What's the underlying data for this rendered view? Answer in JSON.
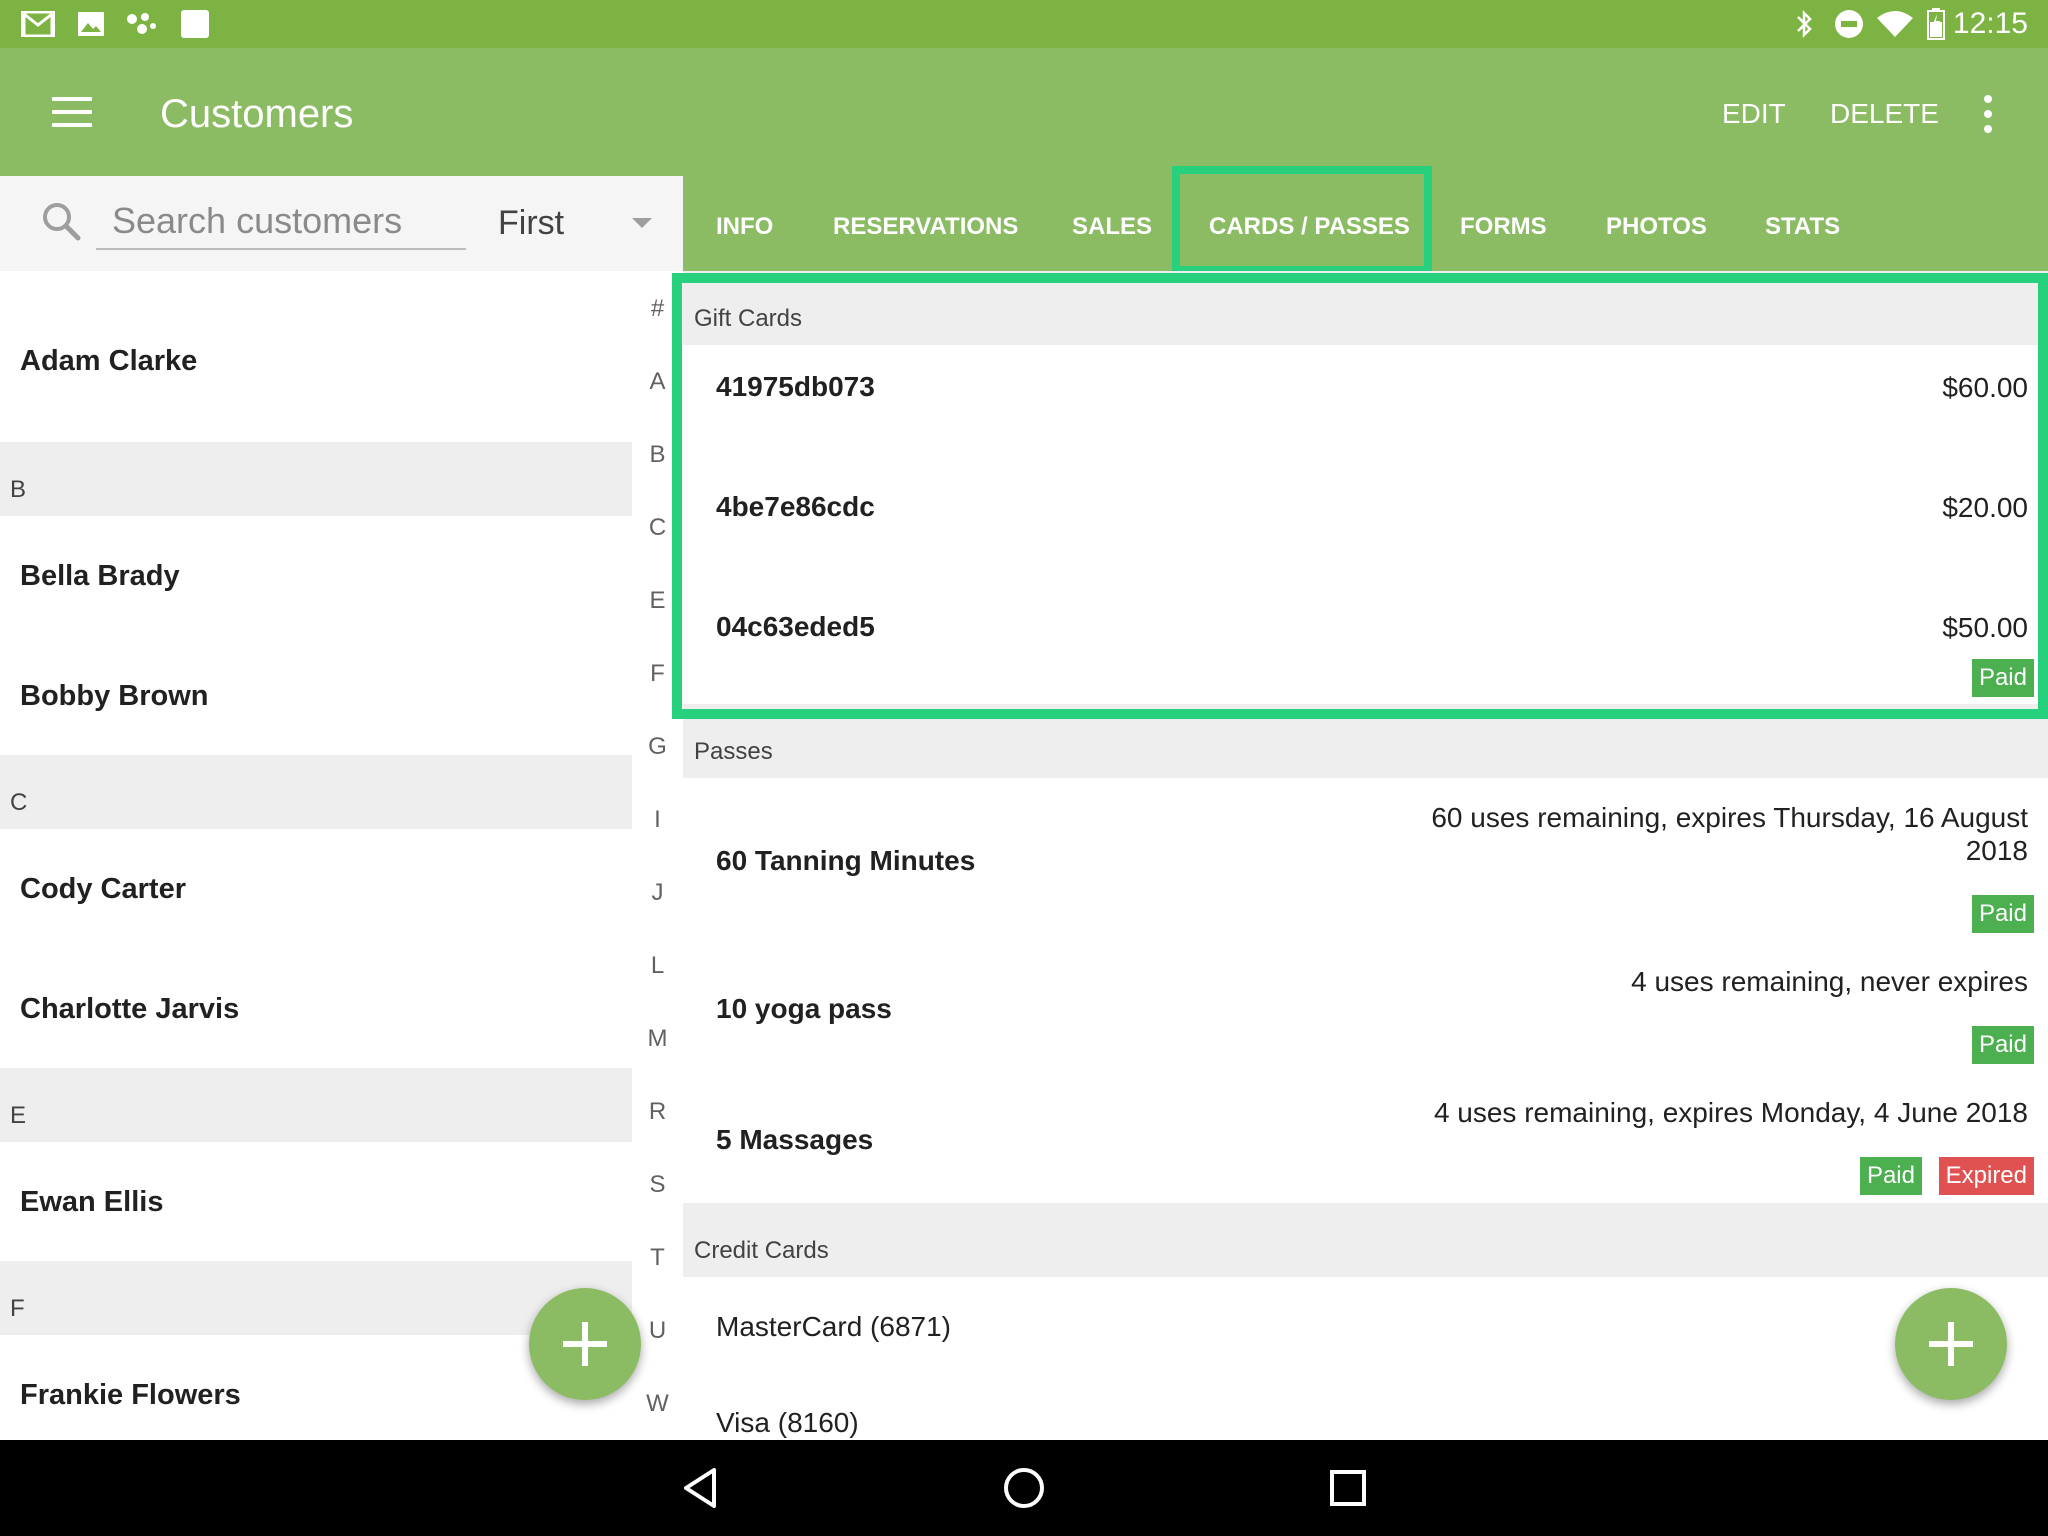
{
  "status_bar": {
    "time": "12:15",
    "left_icons": [
      "gmail-icon",
      "photos-icon",
      "app-icon",
      "square-app-icon"
    ],
    "right_icons": [
      "bluetooth-icon",
      "do-not-disturb-icon",
      "wifi-icon",
      "battery-icon"
    ]
  },
  "app_bar": {
    "title": "Customers",
    "edit_label": "EDIT",
    "delete_label": "DELETE"
  },
  "search": {
    "placeholder": "Search customers",
    "sort_value": "First"
  },
  "customers": {
    "rows": [
      {
        "header": null,
        "name": "Adam Clarke"
      },
      {
        "header": "B",
        "name": "Bella Brady"
      },
      {
        "header": null,
        "name": "Bobby Brown"
      },
      {
        "header": "C",
        "name": "Cody Carter"
      },
      {
        "header": null,
        "name": "Charlotte Jarvis"
      },
      {
        "header": "E",
        "name": "Ewan Ellis"
      },
      {
        "header": "F",
        "name": "Frankie Flowers"
      }
    ],
    "headers": [
      "B",
      "C",
      "E",
      "F"
    ],
    "names": [
      "Adam Clarke",
      "Bella Brady",
      "Bobby Brown",
      "Cody Carter",
      "Charlotte Jarvis",
      "Ewan Ellis",
      "Frankie Flowers"
    ]
  },
  "alphabet_index": [
    "#",
    "A",
    "B",
    "C",
    "E",
    "F",
    "G",
    "I",
    "J",
    "L",
    "M",
    "R",
    "S",
    "T",
    "U",
    "W"
  ],
  "tabs": [
    "INFO",
    "RESERVATIONS",
    "SALES",
    "CARDS / PASSES",
    "FORMS",
    "PHOTOS",
    "STATS"
  ],
  "active_tab": "CARDS / PASSES",
  "gift_cards": {
    "header": "Gift Cards",
    "items": [
      {
        "code": "41975db073",
        "amount": "$60.00"
      },
      {
        "code": "4be7e86cdc",
        "amount": "$20.00"
      },
      {
        "code": "04c63eded5",
        "amount": "$50.00",
        "badge": "Paid"
      }
    ]
  },
  "passes": {
    "header": "Passes",
    "items": [
      {
        "name": "60 Tanning Minutes",
        "status_line1": "60 uses remaining, expires Thursday, 16 August",
        "status_line2": "2018",
        "badge": "Paid"
      },
      {
        "name": "10 yoga pass",
        "status": "4 uses remaining, never expires",
        "badge": "Paid"
      },
      {
        "name": "5 Massages",
        "status": "4 uses remaining, expires Monday, 4 June 2018",
        "badge": "Paid",
        "badge2": "Expired"
      }
    ]
  },
  "credit_cards": {
    "header": "Credit Cards",
    "items": [
      "MasterCard (6871)",
      "Visa (8160)"
    ]
  },
  "colors": {
    "status_bar": "#7cb342",
    "app_bar": "#8bbb63",
    "highlight": "#26d07c",
    "paid": "#4caf50",
    "expired": "#e05151"
  }
}
